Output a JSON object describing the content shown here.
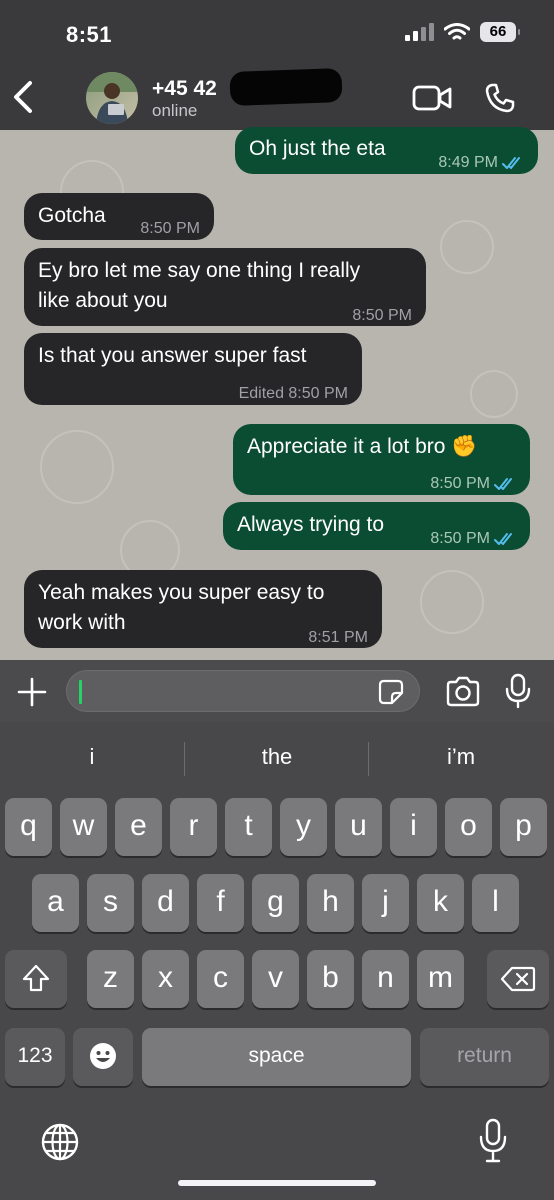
{
  "status_bar": {
    "time": "8:51",
    "battery": "66"
  },
  "header": {
    "contact_name": "+45 42",
    "contact_status": "online"
  },
  "messages": [
    {
      "direction": "out",
      "text": "Oh just the eta",
      "time": "8:49 PM",
      "read": true
    },
    {
      "direction": "in",
      "text": "Gotcha",
      "time": "8:50 PM"
    },
    {
      "direction": "in",
      "line1": "Ey bro let me say one thing I really",
      "line2": "like about you",
      "time": "8:50 PM"
    },
    {
      "direction": "in",
      "text": "Is that you answer super fast",
      "time": "Edited 8:50 PM"
    },
    {
      "direction": "out",
      "text": "Appreciate it a lot bro ✊",
      "time": "8:50 PM",
      "read": true
    },
    {
      "direction": "out",
      "text": "Always trying to",
      "time": "8:50 PM",
      "read": true
    },
    {
      "direction": "in",
      "line1": "Yeah makes you super easy to",
      "line2": "work with",
      "time": "8:51 PM"
    }
  ],
  "composer": {
    "value": ""
  },
  "keyboard": {
    "suggestions": [
      "i",
      "the",
      "i’m"
    ],
    "row1": [
      "q",
      "w",
      "e",
      "r",
      "t",
      "y",
      "u",
      "i",
      "o",
      "p"
    ],
    "row2": [
      "a",
      "s",
      "d",
      "f",
      "g",
      "h",
      "j",
      "k",
      "l"
    ],
    "row3": [
      "z",
      "x",
      "c",
      "v",
      "b",
      "n",
      "m"
    ],
    "numbers_label": "123",
    "space_label": "space",
    "return_label": "return"
  },
  "colors": {
    "outgoing_bubble": "#0b4d32",
    "incoming_bubble": "#262628",
    "read_ticks": "#53bdeb",
    "caret": "#25d366"
  }
}
